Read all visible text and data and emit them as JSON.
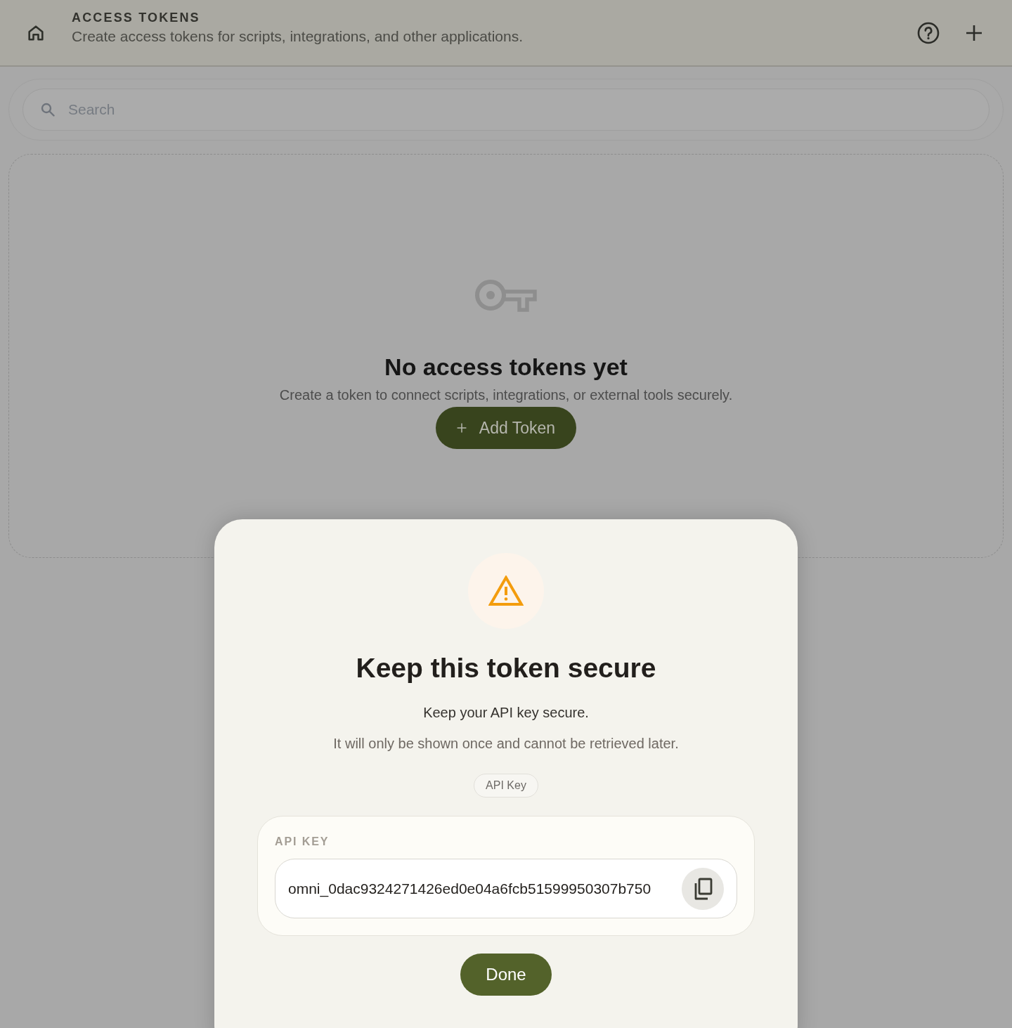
{
  "header": {
    "title": "ACCESS TOKENS",
    "subtitle": "Create access tokens for scripts, integrations, and other applications."
  },
  "search": {
    "placeholder": "Search"
  },
  "empty_state": {
    "title": "No access tokens yet",
    "description": "Create a token to connect scripts, integrations, or external tools securely.",
    "button": "Add Token"
  },
  "dialog": {
    "title": "Keep this token secure",
    "message": "Keep your API key secure.",
    "note": "It will only be shown once and cannot be retrieved later.",
    "badge": "API Key",
    "key_panel": {
      "label": "API KEY",
      "value": "omni_0dac9324271426ed0e04a6fcb51599950307b750"
    },
    "button": "Done"
  }
}
